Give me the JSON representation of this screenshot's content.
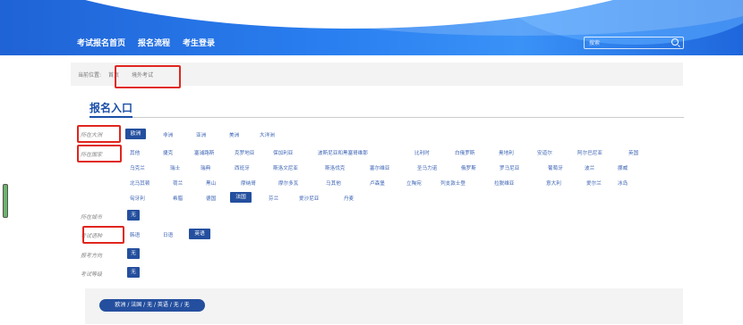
{
  "nav": {
    "items": [
      "考试报名首页",
      "报名流程",
      "考生登录"
    ]
  },
  "search": {
    "placeholder": "搜索"
  },
  "breadcrumb": {
    "prefix": "当前位置:",
    "home": "首页",
    "current": "境外考试"
  },
  "page_title": "报名入口",
  "labels": {
    "continent": "所在大洲",
    "country": "所在国家",
    "city": "所在城市",
    "language": "考试语种",
    "direction": "报考方向",
    "level": "考试等级"
  },
  "continents": [
    "欧洲",
    "非洲",
    "亚洲",
    "美洲",
    "大洋洲"
  ],
  "countries": {
    "row1": [
      "其他",
      "捷克",
      "塞浦路斯",
      "克罗地亚",
      "保加利亚",
      "波斯尼亚和黑塞哥维那",
      "比利时",
      "白俄罗斯",
      "奥地利",
      "安道尔",
      "阿尔巴尼亚",
      "英国"
    ],
    "row2": [
      "乌克兰",
      "瑞士",
      "瑞典",
      "西班牙",
      "斯洛文尼亚",
      "斯洛伐克",
      "塞尔维亚",
      "圣马力诺",
      "俄罗斯",
      "罗马尼亚",
      "葡萄牙",
      "波兰",
      "挪威"
    ],
    "row3": [
      "北马其顿",
      "荷兰",
      "黑山",
      "摩纳哥",
      "摩尔多瓦",
      "马其他",
      "卢森堡",
      "立陶宛",
      "列支敦士登",
      "拉脱维亚",
      "意大利",
      "爱尔兰",
      "冰岛"
    ],
    "row4": [
      "匈牙利",
      "希腊",
      "德国",
      "法国",
      "芬兰",
      "爱沙尼亚",
      "丹麦"
    ]
  },
  "city": {
    "selected": "无"
  },
  "languages": [
    "韩语",
    "日语",
    "英语"
  ],
  "direction": {
    "selected": "无"
  },
  "level": {
    "selected": "无"
  },
  "summary": "欧洲 / 法国 / 无 / 英语 / 无 / 无",
  "colors": {
    "accent": "#244f9e",
    "link": "#3b63b5",
    "highlight_box": "#e0261e"
  }
}
